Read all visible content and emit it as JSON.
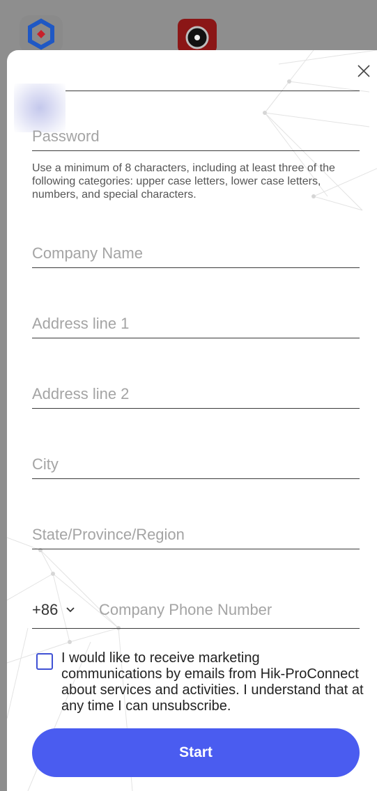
{
  "background_apps": {
    "icon_1": "hexagon-app-icon",
    "icon_2": "camera-app-icon"
  },
  "dialog": {
    "close_icon": "close-icon"
  },
  "form": {
    "password": {
      "placeholder": "Password",
      "value": ""
    },
    "password_hint": "Use a minimum of 8 characters, including at least three of the following categories: upper case letters, lower case letters, numbers, and special characters.",
    "company_name": {
      "placeholder": "Company Name",
      "value": ""
    },
    "address_line_1": {
      "placeholder": "Address line 1",
      "value": ""
    },
    "address_line_2": {
      "placeholder": "Address line 2",
      "value": ""
    },
    "city": {
      "placeholder": "City",
      "value": ""
    },
    "state": {
      "placeholder": "State/Province/Region",
      "value": ""
    },
    "country_code": "+86",
    "phone": {
      "placeholder": "Company Phone Number",
      "value": ""
    },
    "marketing_consent": {
      "checked": false,
      "text": "I would like to receive marketing communications by emails from Hik-ProConnect about services and activities. I understand that at any time I can unsubscribe."
    },
    "start_label": "Start"
  },
  "colors": {
    "accent": "#4a5cf0",
    "checkbox_border": "#3f51d4",
    "overlay": "#8e8e8e"
  }
}
